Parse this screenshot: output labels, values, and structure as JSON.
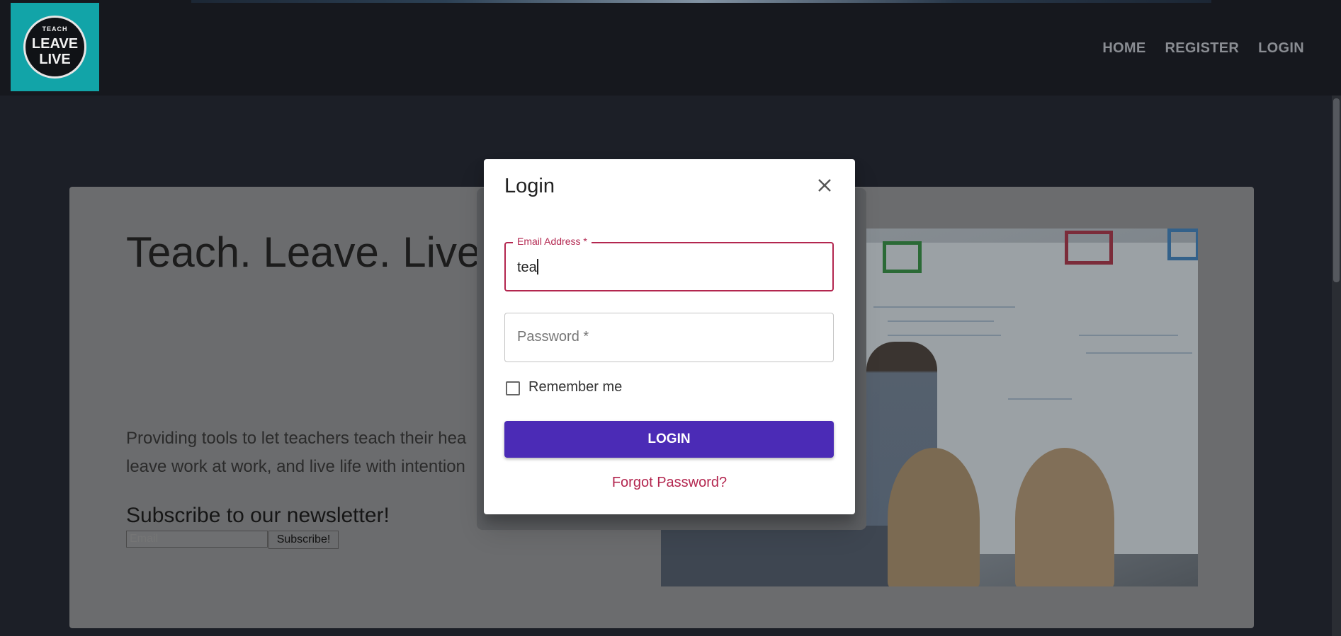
{
  "header": {
    "logo": {
      "line1": "TEACH",
      "line2": "LEAVE",
      "line3": "LIVE"
    },
    "nav": {
      "home": "HOME",
      "register": "REGISTER",
      "login": "LOGIN"
    }
  },
  "hero": {
    "title": "Teach. Leave. Live.",
    "description_line1": "Providing tools to let teachers teach their hea",
    "description_line2": "leave work at work, and live life with intention"
  },
  "newsletter": {
    "title": "Subscribe to our newsletter!",
    "email_placeholder": "Email",
    "button_label": "Subscribe!"
  },
  "login_modal": {
    "title": "Login",
    "email": {
      "label": "Email Address *",
      "value": "tea"
    },
    "password": {
      "placeholder": "Password *"
    },
    "remember_label": "Remember me",
    "login_button": "LOGIN",
    "forgot_link": "Forgot Password?"
  },
  "colors": {
    "accent": "#b3264f",
    "primary_button": "#4b2bb6",
    "logo_bg": "#12a4a8"
  },
  "icons": [
    "close-icon",
    "mouse-cursor-icon"
  ]
}
